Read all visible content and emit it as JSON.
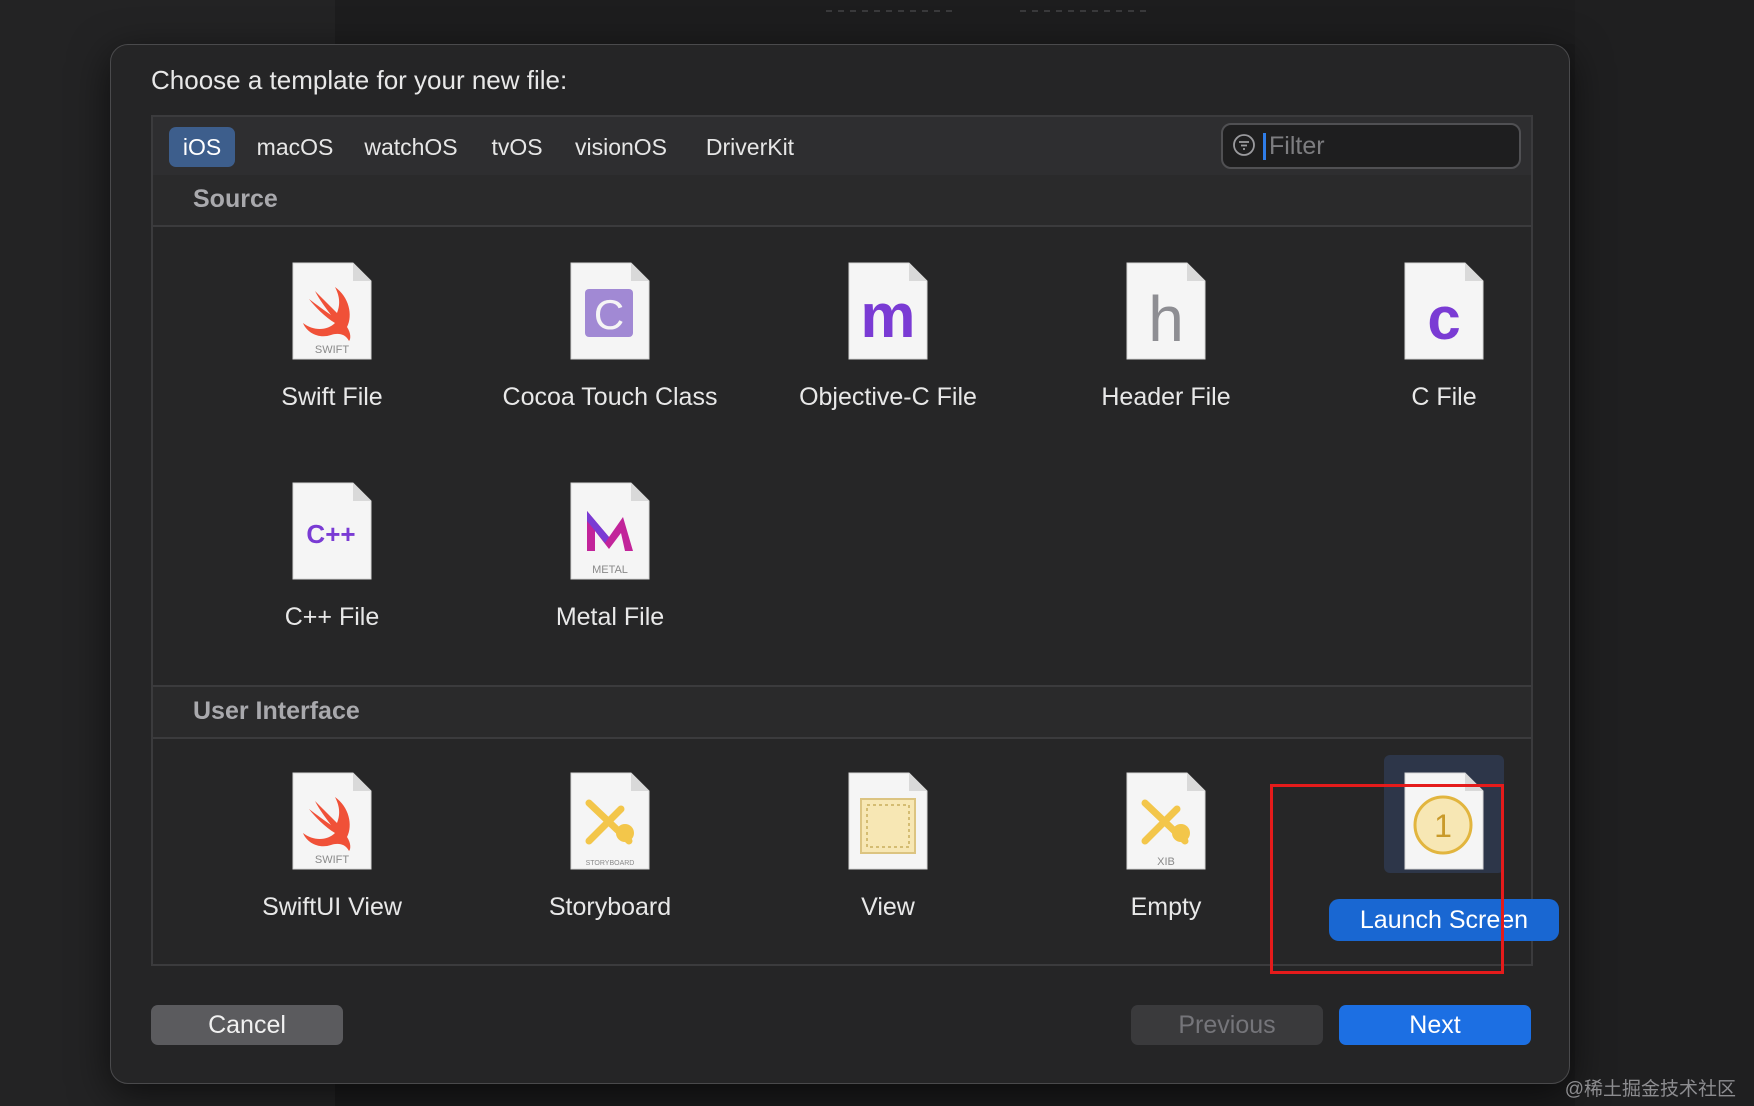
{
  "dialog": {
    "title": "Choose a template for your new file:"
  },
  "tabs": [
    {
      "label": "iOS",
      "active": true
    },
    {
      "label": "macOS"
    },
    {
      "label": "watchOS"
    },
    {
      "label": "tvOS"
    },
    {
      "label": "visionOS"
    },
    {
      "label": "DriverKit"
    }
  ],
  "filter": {
    "placeholder": "Filter",
    "value": ""
  },
  "sections": {
    "source": {
      "label": "Source",
      "items": [
        {
          "label": "Swift File",
          "icon": "swift-file-icon",
          "badge": "SWIFT"
        },
        {
          "label": "Cocoa Touch Class",
          "icon": "cocoa-touch-class-icon",
          "glyph": "C"
        },
        {
          "label": "Objective-C File",
          "icon": "objective-c-file-icon",
          "glyph": "m"
        },
        {
          "label": "Header File",
          "icon": "header-file-icon",
          "glyph": "h"
        },
        {
          "label": "C File",
          "icon": "c-file-icon",
          "glyph": "c"
        },
        {
          "label": "C++ File",
          "icon": "cpp-file-icon",
          "glyph": "C++"
        },
        {
          "label": "Metal File",
          "icon": "metal-file-icon",
          "badge": "METAL"
        }
      ]
    },
    "ui": {
      "label": "User Interface",
      "items": [
        {
          "label": "SwiftUI View",
          "icon": "swiftui-view-icon",
          "badge": "SWIFT"
        },
        {
          "label": "Storyboard",
          "icon": "storyboard-icon",
          "badge": "STORYBOARD"
        },
        {
          "label": "View",
          "icon": "view-file-icon"
        },
        {
          "label": "Empty",
          "icon": "xib-empty-icon",
          "badge": "XIB"
        },
        {
          "label": "Launch Screen",
          "icon": "launch-screen-icon",
          "glyph": "1",
          "selected": true
        }
      ]
    }
  },
  "buttons": {
    "cancel": "Cancel",
    "previous": "Previous",
    "next": "Next"
  },
  "colors": {
    "accent": "#1c6fe3",
    "selection_frame": "#e51b1b",
    "purple": "#7a3bd4",
    "swift_orange": "#f05138",
    "launch_yellow": "#e2b53e"
  },
  "watermark": "@稀土掘金技术社区"
}
